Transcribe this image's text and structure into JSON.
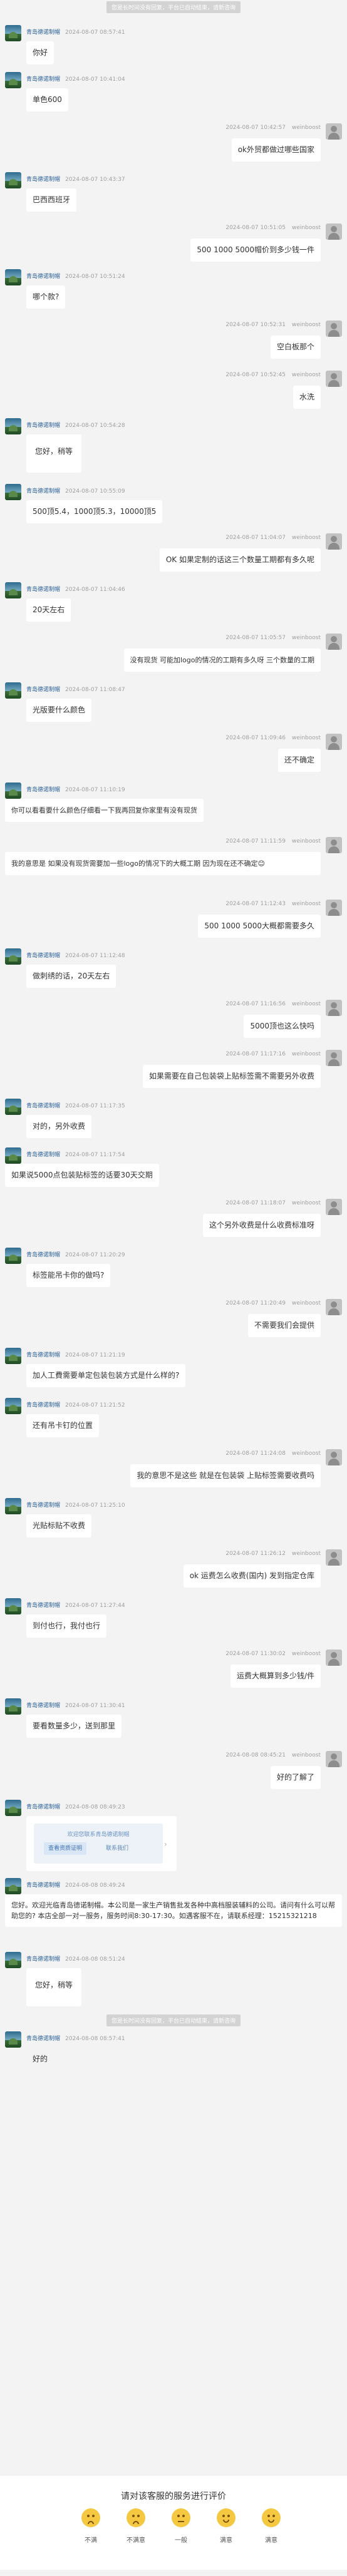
{
  "system_notice": "您是长时间没有回复，平台已自动结束，请新咨询",
  "agent": "青岛德诺制帽",
  "customer": "weinboost",
  "messages": [
    {
      "side": "left",
      "time": "2024-08-07 08:57:41",
      "text": "你好"
    },
    {
      "side": "left",
      "time": "2024-08-07 10:41:04",
      "text": "单色600"
    },
    {
      "side": "right",
      "time": "2024-08-07 10:42:57",
      "text": "ok外贸都做过哪些国家"
    },
    {
      "side": "left",
      "time": "2024-08-07 10:43:37",
      "text": "巴西西班牙"
    },
    {
      "side": "right",
      "time": "2024-08-07 10:51:05",
      "text": "500 1000 5000帽价到多少钱一件"
    },
    {
      "side": "left",
      "time": "2024-08-07 10:51:24",
      "text": "哪个款?"
    },
    {
      "side": "right",
      "time": "2024-08-07 10:52:31",
      "text": "空白板那个"
    },
    {
      "side": "right",
      "time": "2024-08-07 10:52:45",
      "text": "水洗"
    },
    {
      "side": "left",
      "time": "2024-08-07 10:54:28",
      "text": "您好，稍等"
    },
    {
      "side": "left",
      "time": "2024-08-07 10:55:09",
      "text": "500顶5.4，1000顶5.3，10000顶5"
    },
    {
      "side": "right",
      "time": "2024-08-07 11:04:07",
      "text": "OK 如果定制的话这三个数量工期都有多久呢"
    },
    {
      "side": "left",
      "time": "2024-08-07 11:04:46",
      "text": "20天左右"
    },
    {
      "side": "right",
      "time": "2024-08-07 11:05:57",
      "text": "没有现货 可能加logo的情况的工期有多久呀 三个数量的工期"
    },
    {
      "side": "left",
      "time": "2024-08-07 11:08:47",
      "text": "光版要什么颜色"
    },
    {
      "side": "right",
      "time": "2024-08-07 11:09:46",
      "text": "还不确定"
    },
    {
      "side": "left",
      "time": "2024-08-07 11:10:19",
      "text": "你可以看看要什么颜色仔细看一下我再回复你家里有没有现货"
    },
    {
      "side": "right",
      "time": "2024-08-07 11:11:59",
      "text": "我的意思是 如果没有现货需要加一些logo的情况下的大概工期 因为现在还不确定😊"
    },
    {
      "side": "right",
      "time": "2024-08-07 11:12:43",
      "text": "500 1000 5000大概都需要多久"
    },
    {
      "side": "left",
      "time": "2024-08-07 11:12:48",
      "text": "做刺绣的话，20天左右"
    },
    {
      "side": "right",
      "time": "2024-08-07 11:16:56",
      "text": "5000顶也这么快吗"
    },
    {
      "side": "right",
      "time": "2024-08-07 11:17:16",
      "text": "如果需要在自己包装袋上贴标签需不需要另外收费"
    },
    {
      "side": "left",
      "time": "2024-08-07 11:17:35",
      "text": "对的，另外收费"
    },
    {
      "side": "left",
      "time": "2024-08-07 11:17:54",
      "text": "如果说5000点包装贴标签的话要30天交期"
    },
    {
      "side": "right",
      "time": "2024-08-07 11:18:07",
      "text": "这个另外收费是什么收费标准呀"
    },
    {
      "side": "left",
      "time": "2024-08-07 11:20:29",
      "text": "标签能吊卡你的做吗?"
    },
    {
      "side": "right",
      "time": "2024-08-07 11:20:49",
      "text": "不需要我们会提供"
    },
    {
      "side": "left",
      "time": "2024-08-07 11:21:19",
      "text": "加人工費需要单定包装包装方式是什么样的?"
    },
    {
      "side": "left",
      "time": "2024-08-07 11:21:52",
      "text": "还有吊卡钉的位置"
    },
    {
      "side": "right",
      "time": "2024-08-07 11:24:08",
      "text": "我的意思不是这些 就是在包装袋 上贴标签需要收费吗"
    },
    {
      "side": "left",
      "time": "2024-08-07 11:25:10",
      "text": "光贴标贴不收费"
    },
    {
      "side": "right",
      "time": "2024-08-07 11:26:12",
      "text": "ok 运费怎么收费(国内) 发到指定仓库"
    },
    {
      "side": "left",
      "time": "2024-08-07 11:27:44",
      "text": "到付也行，我付也行"
    },
    {
      "side": "right",
      "time": "2024-08-07 11:30:02",
      "text": "运费大概算到多少钱/件"
    },
    {
      "side": "left",
      "time": "2024-08-07 11:30:41",
      "text": "要看数量多少，送到那里"
    },
    {
      "side": "right",
      "time": "2024-08-08 08:45:21",
      "text": "好的了解了"
    },
    {
      "side": "left",
      "time": "2024-08-08 08:49:23",
      "card": {
        "title": "欢迎您联系青岛德诺制帽",
        "btn1": "查看资质证明",
        "btn2": "联系我们"
      }
    },
    {
      "side": "left",
      "time": "2024-08-08 08:49:24",
      "text": "您好。欢迎光临青岛德诺制帽。本公司是一家生产销售批发各种中高档服装辅料的公司。请问有什么可以帮助您的? 本店全部一对一服务，服务时间8:30-17:30。如遇客服不在，请联系经理：15215321218"
    },
    {
      "side": "left",
      "time": "2024-08-08 08:51:24",
      "text": "您好，稍等"
    },
    {
      "side": "left",
      "time": "2024-08-08 08:57:41",
      "text": "好的"
    }
  ],
  "rating": {
    "title": "请对该客服的服务进行评价",
    "options": [
      {
        "label": "不满",
        "icon": "angry-face-icon"
      },
      {
        "label": "不满意",
        "icon": "sad-face-icon"
      },
      {
        "label": "一般",
        "icon": "neutral-face-icon"
      },
      {
        "label": "满意",
        "icon": "smile-face-icon"
      },
      {
        "label": "满意",
        "icon": "happy-face-icon"
      }
    ]
  },
  "colors": {
    "background": "#f3f3f3",
    "agent_name": "#2a5f97",
    "bubble": "#ffffff"
  }
}
